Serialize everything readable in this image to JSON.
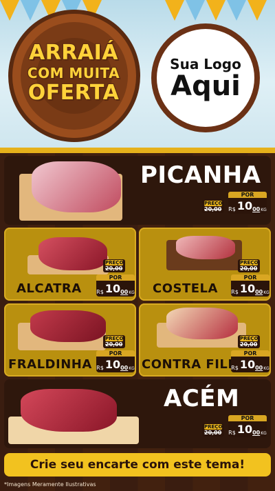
{
  "header": {
    "brand_line1": "ARRAIÁ",
    "brand_line2": "COM MUITA",
    "brand_line3": "OFERTA",
    "logo_line1": "Sua Logo",
    "logo_line2": "Aqui"
  },
  "colors": {
    "gold": "#e6b11b",
    "wood_dark": "#3a1d10",
    "meat": "#b8233a"
  },
  "products": [
    {
      "name": "PICANHA",
      "old_label": "PREÇO",
      "old_price": "20,00",
      "por": "POR",
      "currency": "R$",
      "price": "10",
      "cents": "00",
      "unit": "KG"
    },
    {
      "name": "ALCATRA",
      "old_label": "PREÇO",
      "old_price": "20,00",
      "por": "POR",
      "currency": "R$",
      "price": "10",
      "cents": "00",
      "unit": "KG"
    },
    {
      "name": "COSTELA",
      "old_label": "PREÇO",
      "old_price": "20,00",
      "por": "POR",
      "currency": "R$",
      "price": "10",
      "cents": "00",
      "unit": "KG"
    },
    {
      "name": "FRALDINHA",
      "old_label": "PREÇO",
      "old_price": "20,00",
      "por": "POR",
      "currency": "R$",
      "price": "10",
      "cents": "00",
      "unit": "KG"
    },
    {
      "name": "CONTRA FILÉ",
      "old_label": "PREÇO",
      "old_price": "20,00",
      "por": "POR",
      "currency": "R$",
      "price": "10",
      "cents": "00",
      "unit": "KG"
    },
    {
      "name": "ACÉM",
      "old_label": "PREÇO",
      "old_price": "20,00",
      "por": "POR",
      "currency": "R$",
      "price": "10",
      "cents": "00",
      "unit": "KG"
    }
  ],
  "cta": "Crie seu encarte com este tema!",
  "disclaimer": "*Imagens Meramente Ilustrativas"
}
